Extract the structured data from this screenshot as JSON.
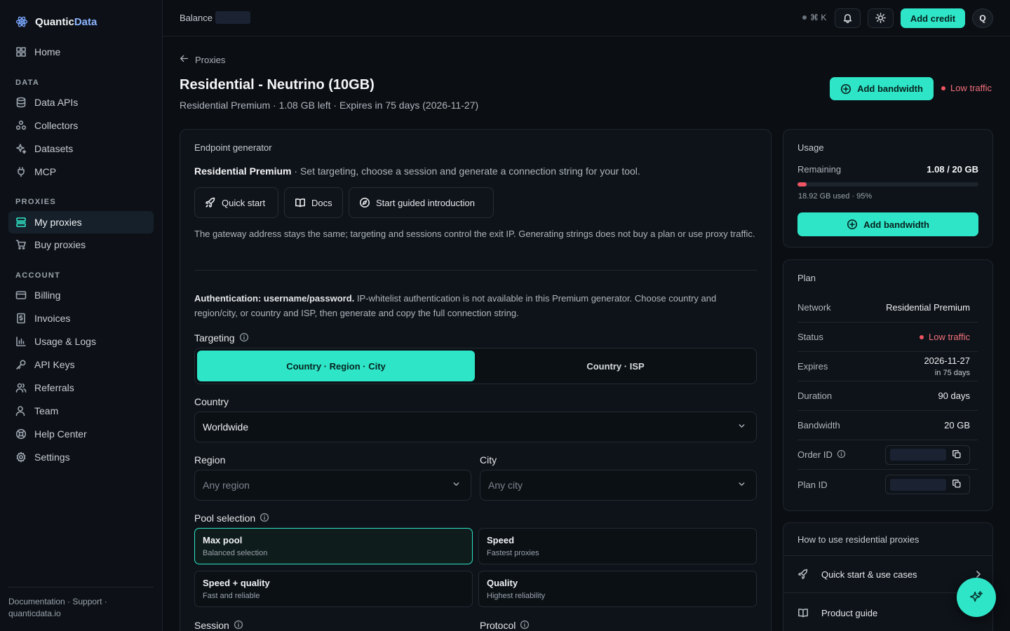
{
  "brand": {
    "name_a": "Quantic",
    "name_b": "Data"
  },
  "sidebar": {
    "home": "Home",
    "data_section": "DATA",
    "data_items": [
      "Data APIs",
      "Collectors",
      "Datasets",
      "MCP"
    ],
    "proxies_section": "PROXIES",
    "proxies_items": [
      "My proxies",
      "Buy proxies"
    ],
    "account_section": "ACCOUNT",
    "account_items": [
      "Billing",
      "Invoices",
      "Usage & Logs",
      "API Keys",
      "Referrals",
      "Team",
      "Help Center",
      "Settings"
    ],
    "footer_line1": "Documentation · Support ·",
    "footer_line2": "quanticdata.io"
  },
  "topbar": {
    "balance_label": "Balance",
    "shortcut": "⌘ K",
    "add_credit": "Add credit",
    "avatar_initial": "Q"
  },
  "header": {
    "back_label": "Proxies",
    "title": "Residential - Neutrino (10GB)",
    "subtitle": "Residential Premium · 1.08 GB left · Expires in 75 days (2026-11-27)",
    "add_bandwidth": "Add bandwidth",
    "status": "Low traffic"
  },
  "generator": {
    "title": "Endpoint generator",
    "intro_bold": "Residential Premium",
    "intro_rest": " · Set targeting, choose a session and generate a connection string for your tool.",
    "quick_start": "Quick start",
    "docs": "Docs",
    "guided": "Start guided introduction",
    "note": "The gateway address stays the same; targeting and sessions control the exit IP. Generating strings does not buy a plan or use proxy traffic.",
    "auth_bold": "Authentication: username/password.",
    "auth_rest": " IP-whitelist authentication is not available in this Premium generator. Choose country and region/city, or country and ISP, then generate and copy the full connection string.",
    "targeting_label": "Targeting",
    "targeting_options": [
      "Country · Region · City",
      "Country · ISP"
    ],
    "country_label": "Country",
    "country_value": "Worldwide",
    "region_label": "Region",
    "region_placeholder": "Any region",
    "city_label": "City",
    "city_placeholder": "Any city",
    "pool_label": "Pool selection",
    "pools": [
      {
        "title": "Max pool",
        "sub": "Balanced selection"
      },
      {
        "title": "Speed",
        "sub": "Fastest proxies"
      },
      {
        "title": "Speed + quality",
        "sub": "Fast and reliable"
      },
      {
        "title": "Quality",
        "sub": "Highest reliability"
      }
    ],
    "session_label": "Session",
    "protocol_label": "Protocol"
  },
  "usage": {
    "title": "Usage",
    "remaining_label": "Remaining",
    "remaining_value": "1.08 / 20 GB",
    "used_fraction": 0.05,
    "used_text": "18.92 GB used · 95%",
    "add_bandwidth": "Add bandwidth"
  },
  "plan": {
    "title": "Plan",
    "network_label": "Network",
    "network_value": "Residential Premium",
    "status_label": "Status",
    "status_value": "Low traffic",
    "expires_label": "Expires",
    "expires_date": "2026-11-27",
    "expires_rel": "in 75 days",
    "duration_label": "Duration",
    "duration_value": "90 days",
    "bandwidth_label": "Bandwidth",
    "bandwidth_value": "20 GB",
    "order_label": "Order ID",
    "plan_id_label": "Plan ID"
  },
  "help": {
    "title": "How to use residential proxies",
    "items": [
      "Quick start & use cases",
      "Product guide"
    ]
  },
  "colors": {
    "accent": "#2ee5c8",
    "danger": "#f05563",
    "background": "#0b0e13"
  }
}
